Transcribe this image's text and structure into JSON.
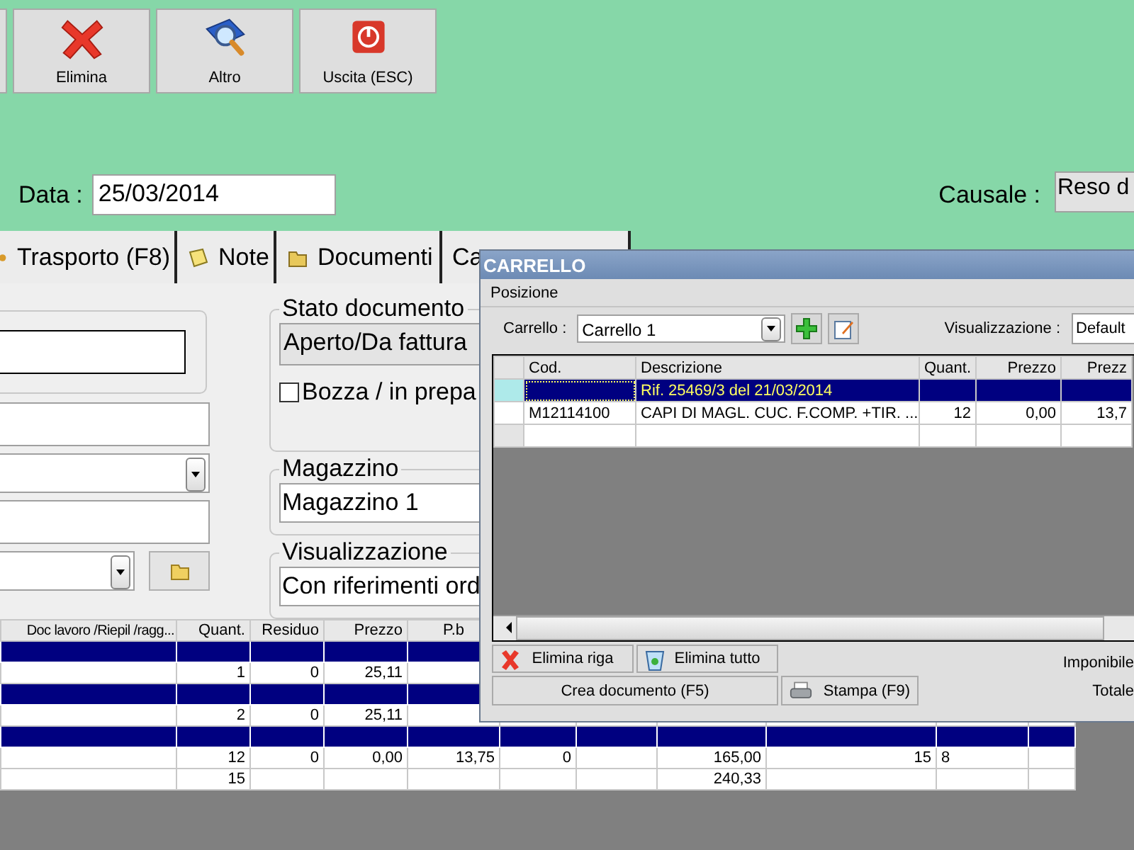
{
  "toolbar": [
    {
      "kind": "delete",
      "label": "Elimina"
    },
    {
      "kind": "search",
      "label": "Altro"
    },
    {
      "kind": "exit",
      "label": "Uscita (ESC)"
    }
  ],
  "date": {
    "label": "Data :",
    "value": "25/03/2014"
  },
  "causale": {
    "label": "Causale :",
    "value": "Reso d"
  },
  "tabs": [
    {
      "kind": "transport",
      "label": "Trasporto (F8)",
      "selected": false
    },
    {
      "kind": "notes",
      "label": "Note",
      "selected": false
    },
    {
      "kind": "documents",
      "label": "Documenti",
      "selected": false
    },
    {
      "kind": "plain",
      "label": "Ca",
      "selected": false
    }
  ],
  "status_group": {
    "legend": "Stato documento",
    "value": "Aperto/Da fattura",
    "draft": {
      "label": "Bozza / in prepa",
      "checked": false
    }
  },
  "warehouse": {
    "legend": "Magazzino",
    "value": "Magazzino 1"
  },
  "view": {
    "legend": "Visualizzazione",
    "value": "Con riferimenti ord"
  },
  "table": {
    "columns": [
      "Doc lavoro /Riepil /ragg...",
      "Quant.",
      "Residuo",
      "Prezzo",
      "P.b"
    ],
    "rows": [
      {
        "kind": "group"
      },
      {
        "kind": "item",
        "cells": [
          null,
          "1",
          "0",
          "25,11"
        ]
      },
      {
        "kind": "group"
      },
      {
        "kind": "item",
        "cells": [
          null,
          "2",
          "0",
          "25,11"
        ]
      },
      {
        "kind": "group"
      },
      {
        "kind": "item",
        "cells": [
          null,
          "12",
          "0",
          "0,00",
          "13,75",
          "0",
          null,
          "165,00",
          "15",
          "8"
        ]
      },
      {
        "kind": "total",
        "cells": [
          null,
          "15",
          null,
          null,
          null,
          null,
          null,
          "240,33"
        ]
      }
    ]
  },
  "dialog": {
    "title": "CARRELLO",
    "menu": [
      "Posizione"
    ],
    "cart": {
      "label": "Carrello :",
      "value": "Carrello 1"
    },
    "view": {
      "label": "Visualizzazione :",
      "value": "Default"
    },
    "table": {
      "columns": [
        "Cod.",
        "Descrizione",
        "Quant.",
        "Prezzo",
        "Prezz"
      ],
      "rows": [
        {
          "selected": true,
          "cells": [
            null,
            "Rif. 25469/3 del 21/03/2014",
            null,
            null,
            null
          ]
        },
        {
          "selected": false,
          "cells": [
            "M12114100",
            "CAPI DI MAGL. CUC. F.COMP. +TIR. ...",
            "12",
            "0,00",
            "13,7"
          ]
        }
      ]
    },
    "buttons": [
      {
        "kind": "delete",
        "label": "Elimina riga"
      },
      {
        "kind": "clear",
        "label": "Elimina tutto"
      },
      {
        "kind": "create",
        "label": "Crea documento (F5)"
      },
      {
        "kind": "print",
        "label": "Stampa (F9)"
      }
    ],
    "totals": [
      {
        "label": "Imponibile"
      },
      {
        "label": "Totale"
      }
    ]
  }
}
